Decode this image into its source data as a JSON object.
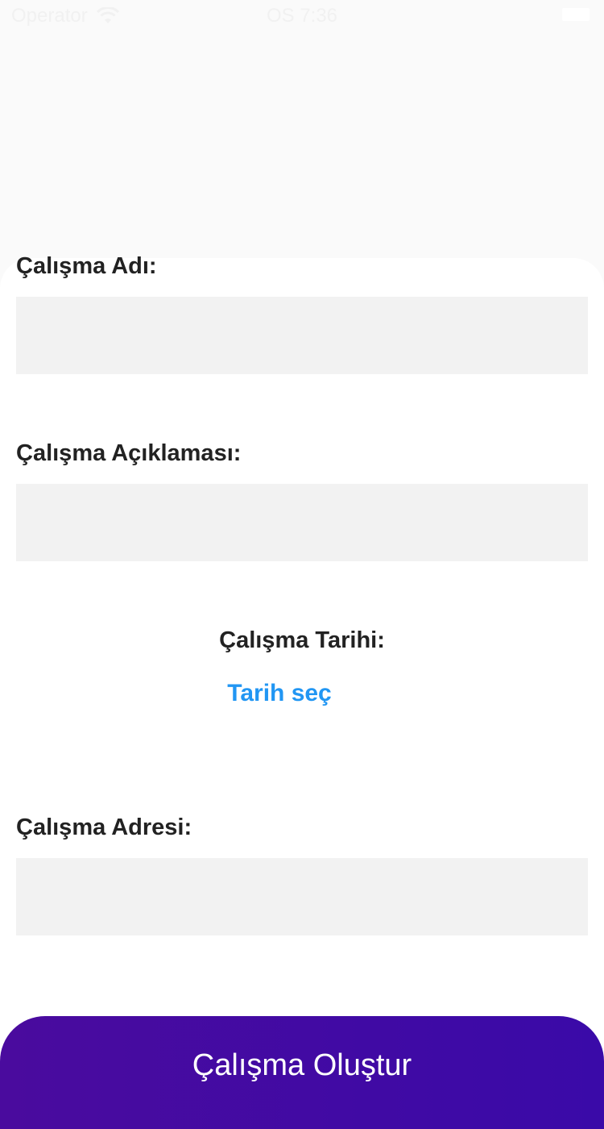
{
  "status_bar": {
    "carrier": "Operator",
    "time": "OS 7:36",
    "wifi_icon": "wifi-icon",
    "battery_icon": "battery-icon"
  },
  "form": {
    "name_label": "Çalışma Adı:",
    "name_value": "",
    "description_label": "Çalışma Açıklaması:",
    "description_value": "",
    "date_label": "Çalışma Tarihi:",
    "date_link": "Tarih seç",
    "address_label": "Çalışma Adresi:",
    "address_value": ""
  },
  "submit_button": {
    "label": "Çalışma Oluştur"
  },
  "colors": {
    "accent": "#2196f3",
    "button_gradient_start": "#4a0b9e",
    "button_gradient_end": "#3a0aa8",
    "field_background": "#f2f2f2"
  }
}
